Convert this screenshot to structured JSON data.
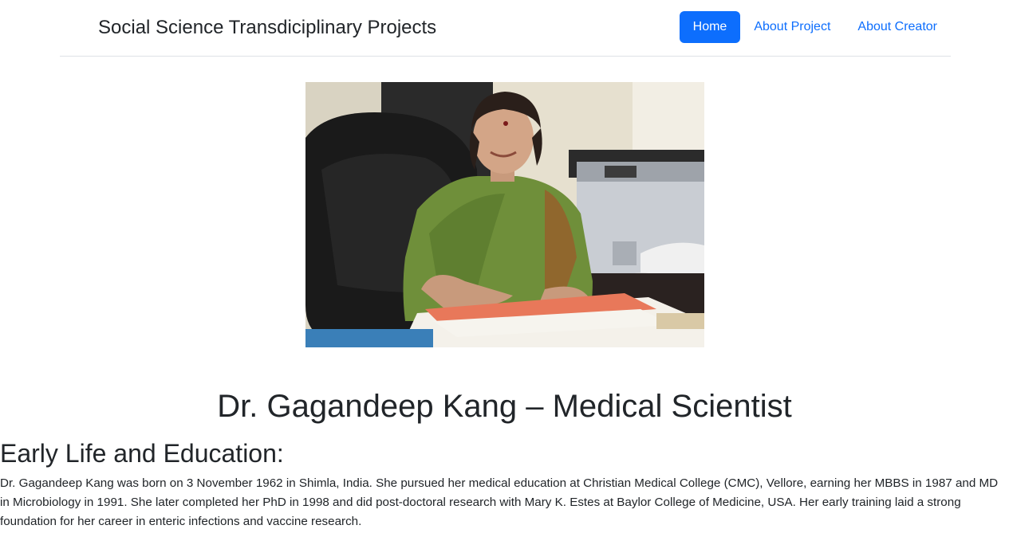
{
  "navbar": {
    "brand": "Social Science Transdiciplinary Projects",
    "links": [
      {
        "label": "Home",
        "active": true
      },
      {
        "label": "About Project",
        "active": false
      },
      {
        "label": "About Creator",
        "active": false
      }
    ]
  },
  "main": {
    "title": "Dr. Gagandeep Kang – Medical Scientist",
    "sections": [
      {
        "heading": "Early Life and Education:",
        "body": "Dr. Gagandeep Kang was born on 3 November 1962 in Shimla, India. She pursued her medical education at Christian Medical College (CMC), Vellore, earning her MBBS in 1987 and MD in Microbiology in 1991. She later completed her PhD in 1998 and did post-doctoral research with Mary K. Estes at Baylor College of Medicine, USA. Her early training laid a strong foundation for her career in enteric infections and vaccine research."
      }
    ]
  },
  "colors": {
    "primary": "#0d6efd",
    "text": "#212529",
    "divider": "#dee2e6"
  }
}
